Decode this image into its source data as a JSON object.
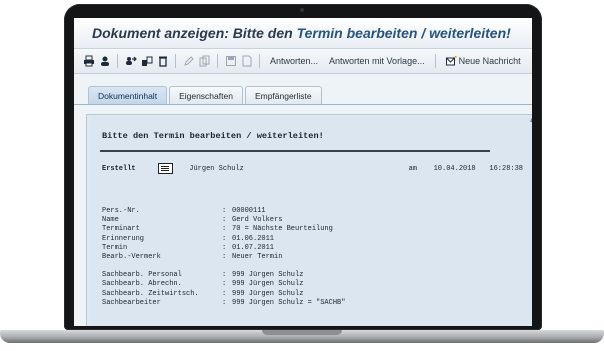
{
  "window": {
    "title_prefix": "Dokument anzeigen: Bitte den ",
    "title_highlight": "Termin bearbeiten / weiterleiten!"
  },
  "toolbar": {
    "icons": [
      "print-icon",
      "user-icon",
      "forward-icon",
      "attach-icon",
      "delete-icon",
      "edit-icon",
      "copy-icon",
      "save-icon",
      "document-icon"
    ],
    "reply_label": "Antworten...",
    "reply_template_label": "Antworten mit Vorlage...",
    "new_message_label": "Neue Nachricht"
  },
  "tabs": [
    {
      "label": "Dokumentinhalt",
      "active": true
    },
    {
      "label": "Eigenschaften",
      "active": false
    },
    {
      "label": "Empfängerliste",
      "active": false
    }
  ],
  "document": {
    "heading": "Bitte den Termin bearbeiten / weiterleiten!",
    "created_label": "Erstellt",
    "author": "Jürgen Schulz",
    "at_label": "am",
    "date": "10.04.2018",
    "time": "16:28:38",
    "fields_group1": [
      {
        "key": "Pers.-Nr.",
        "value": "00000111"
      },
      {
        "key": "Name",
        "value": "Gerd Volkers"
      },
      {
        "key": "Terminart",
        "value": "70 = Nächste Beurteilung"
      },
      {
        "key": "Erinnerung",
        "value": "01.06.2011"
      },
      {
        "key": "Termin",
        "value": "01.07.2011"
      },
      {
        "key": "Bearb.-Vermerk",
        "value": "Neuer Termin"
      }
    ],
    "fields_group2": [
      {
        "key": "Sachbearb. Personal",
        "value": "999 Jürgen Schulz"
      },
      {
        "key": "Sachbearb. Abrechn.",
        "value": "999 Jürgen Schulz"
      },
      {
        "key": "Sachbearb. Zeitwirtsch.",
        "value": "999 Jürgen Schulz"
      },
      {
        "key": "Sachbearbeiter",
        "value": "999 Jürgen Schulz = \"SACHB\""
      }
    ]
  }
}
